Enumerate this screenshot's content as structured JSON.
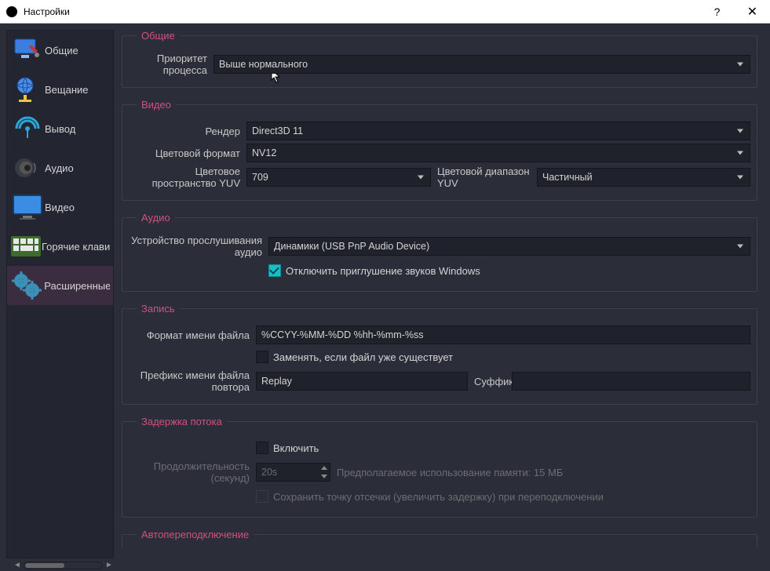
{
  "window": {
    "title": "Настройки"
  },
  "sidebar": {
    "items": [
      {
        "label": "Общие"
      },
      {
        "label": "Вещание"
      },
      {
        "label": "Вывод"
      },
      {
        "label": "Аудио"
      },
      {
        "label": "Видео"
      },
      {
        "label": "Горячие клавиши"
      },
      {
        "label": "Расширенные"
      }
    ]
  },
  "groups": {
    "general": {
      "legend": "Общие",
      "priority_label": "Приоритет процесса",
      "priority_value": "Выше нормального"
    },
    "video": {
      "legend": "Видео",
      "renderer_label": "Рендер",
      "renderer_value": "Direct3D 11",
      "colorformat_label": "Цветовой формат",
      "colorformat_value": "NV12",
      "colorspace_label": "Цветовое пространство YUV",
      "colorspace_value": "709",
      "colorrange_label": "Цветовой диапазон YUV",
      "colorrange_value": "Частичный"
    },
    "audio": {
      "legend": "Аудио",
      "device_label": "Устройство прослушивания аудио",
      "device_value": "Динамики (USB PnP Audio Device)",
      "disable_ducking_label": "Отключить приглушение звуков Windows"
    },
    "recording": {
      "legend": "Запись",
      "filename_label": "Формат имени файла",
      "filename_value": "%CCYY-%MM-%DD %hh-%mm-%ss",
      "overwrite_label": "Заменять, если файл уже существует",
      "prefix_label": "Префикс имени файла повтора",
      "prefix_value": "Replay",
      "suffix_label": "Суффикс",
      "suffix_value": ""
    },
    "delay": {
      "legend": "Задержка потока",
      "enable_label": "Включить",
      "duration_label": "Продолжительность (секунд)",
      "duration_value": "20s",
      "memory_label": "Предполагаемое использование памяти: 15 МБ",
      "preserve_label": "Сохранить точку отсечки (увеличить задержку) при переподключении"
    },
    "autoreconnect": {
      "legend": "Автопереподключение"
    }
  }
}
